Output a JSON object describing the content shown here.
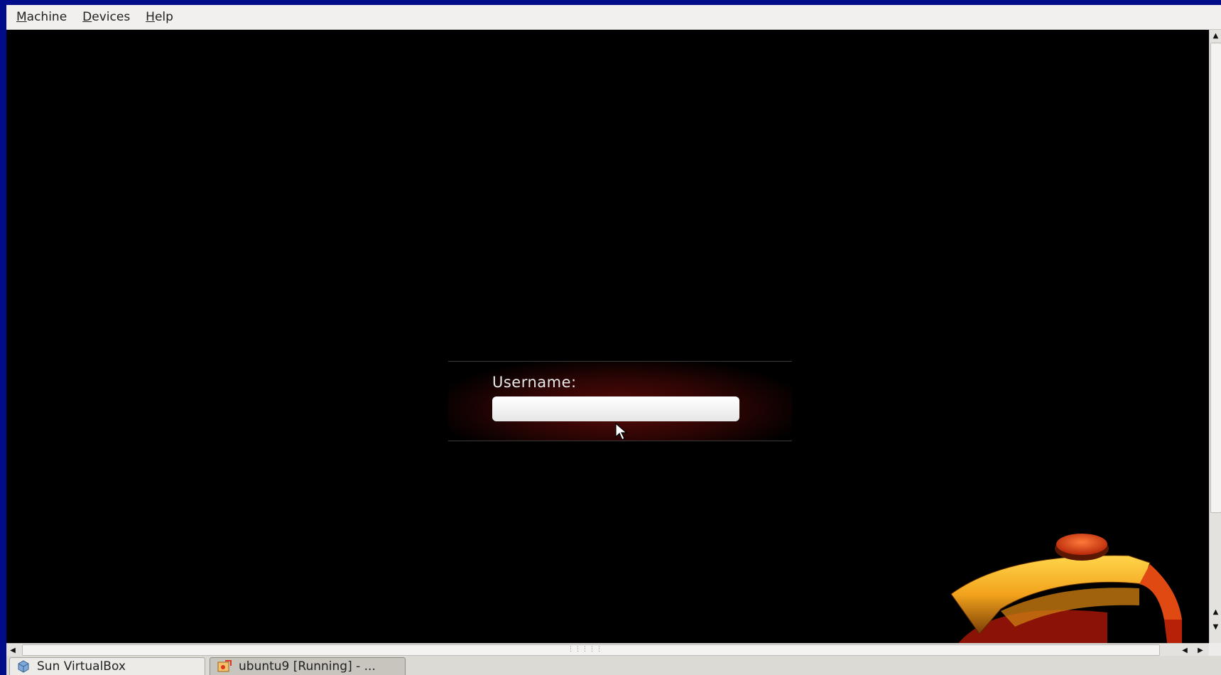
{
  "menubar": {
    "items": [
      {
        "underline": "M",
        "rest": "achine"
      },
      {
        "underline": "D",
        "rest": "evices"
      },
      {
        "underline": "H",
        "rest": "elp"
      }
    ]
  },
  "login": {
    "label": "Username:",
    "value": ""
  },
  "taskbar": {
    "items": [
      {
        "label": "Sun VirtualBox",
        "icon": "virtualbox-icon"
      },
      {
        "label": "ubuntu9 [Running] - ...",
        "icon": "vm-running-icon"
      }
    ]
  },
  "icons": {
    "cursor": "pointer-arrow-icon",
    "logo": "ubuntu-logo"
  },
  "colors": {
    "desktop_background": "#000c8a",
    "login_glow": "#5a0a08",
    "logo_orange": "#f2a21c",
    "logo_red": "#d9360c"
  }
}
